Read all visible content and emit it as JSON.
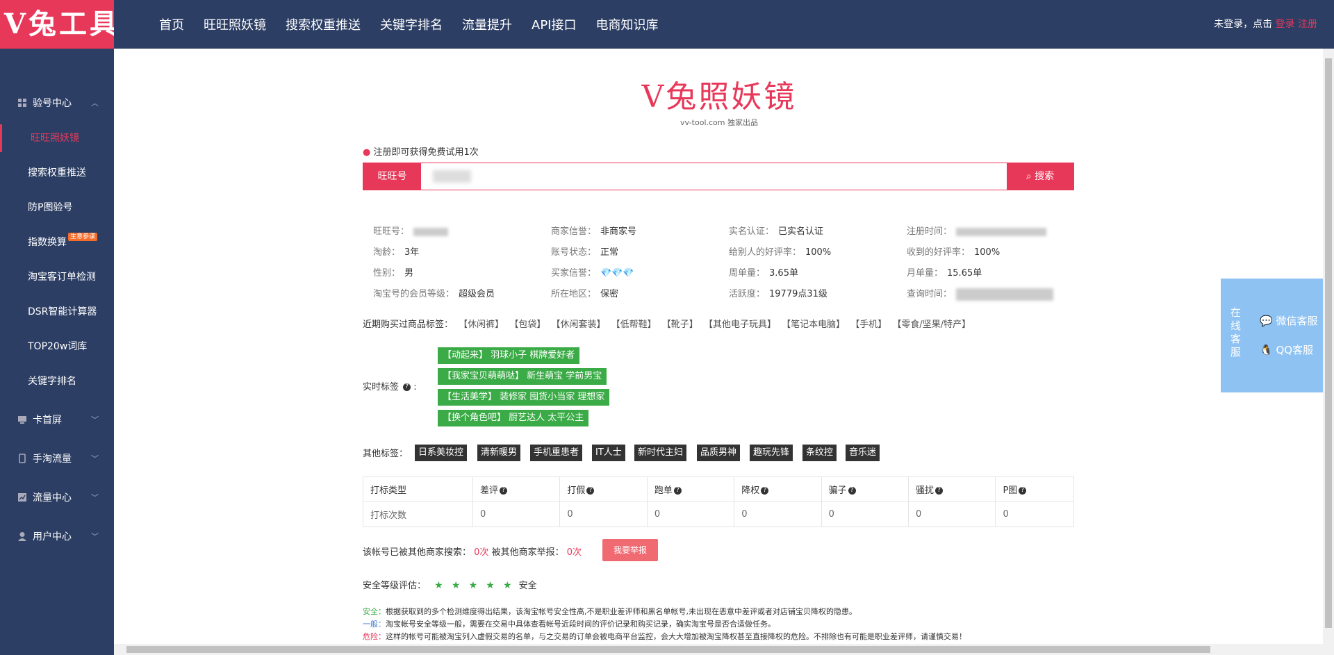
{
  "header": {
    "logo": "V兔工具",
    "nav": [
      "首页",
      "旺旺照妖镜",
      "搜索权重推送",
      "关键字排名",
      "流量提升",
      "API接口",
      "电商知识库"
    ],
    "login_prefix": "未登录，点击",
    "login": "登录",
    "register": "注册"
  },
  "sidebar": {
    "group1": "验号中心",
    "items": [
      "旺旺照妖镜",
      "搜索权重推送",
      "防P图验号",
      "指数换算",
      "淘宝客订单检测",
      "DSR智能计算器",
      "TOP20w词库",
      "关键字排名"
    ],
    "badge": "生意参谋",
    "group2": "卡首屏",
    "group3": "手淘流量",
    "group4": "流量中心",
    "group5": "用户中心"
  },
  "brand": {
    "title": "V兔照妖镜",
    "subtitle": "vv-tool.com 独家出品"
  },
  "tip": "注册即可获得免费试用1次",
  "search": {
    "label": "旺旺号",
    "button": "搜索"
  },
  "info": {
    "ww_label": "旺旺号：",
    "seller_credit_label": "商家信誉：",
    "seller_credit": "非商家号",
    "realname_label": "实名认证：",
    "realname": "已实名认证",
    "reg_time_label": "注册时间：",
    "age_label": "淘龄：",
    "age": "3年",
    "account_status_label": "账号状态：",
    "account_status": "正常",
    "good_rate_give_label": "给别人的好评率：",
    "good_rate_give": "100%",
    "good_rate_recv_label": "收到的好评率：",
    "good_rate_recv": "100%",
    "gender_label": "性别：",
    "gender": "男",
    "buyer_credit_label": "买家信誉：",
    "buyer_credit": "💎💎💎",
    "week_orders_label": "周单量：",
    "week_orders": "3.65单",
    "month_orders_label": "月单量：",
    "month_orders": "15.65单",
    "member_level_label": "淘宝号的会员等级：",
    "member_level": "超级会员",
    "region_label": "所在地区：",
    "region": "保密",
    "activity_label": "活跃度：",
    "activity": "19779点31级",
    "query_time_label": "查询时间："
  },
  "recent_tags": {
    "label": "近期购买过商品标签：",
    "tags": [
      "【休闲裤】",
      "【包袋】",
      "【休闲套装】",
      "【低帮鞋】",
      "【靴子】",
      "【其他电子玩具】",
      "【笔记本电脑】",
      "【手机】",
      "【零食/坚果/特产】"
    ]
  },
  "realtime_tags": {
    "label": "实时标签",
    "tags": [
      "【动起来】 羽球小子 棋牌爱好者",
      "【我家宝贝萌萌哒】 新生萌宝 学前男宝",
      "【生活美学】 装修家 囤货小当家 理想家",
      "【换个角色吧】 厨艺达人 太平公主"
    ]
  },
  "other_tags": {
    "label": "其他标签：",
    "tags": [
      "日系美妆控",
      "清新暖男",
      "手机重患者",
      "IT人士",
      "新时代主妇",
      "品质男神",
      "趣玩先锋",
      "条纹控",
      "音乐迷"
    ]
  },
  "stats": {
    "headers": [
      "打标类型",
      "差评",
      "打假",
      "跑单",
      "降权",
      "骗子",
      "骚扰",
      "P图"
    ],
    "row_label": "打标次数",
    "values": [
      "0",
      "0",
      "0",
      "0",
      "0",
      "0",
      "0"
    ]
  },
  "report": {
    "text1": "该帐号已被其他商家搜索：",
    "count1": "0次",
    "text2": "被其他商家举报：",
    "count2": "0次",
    "button": "我要举报"
  },
  "safety": {
    "label": "安全等级评估：",
    "level": "安全",
    "stars": 5
  },
  "notes": {
    "safe_label": "安全：",
    "safe": "根据获取到的多个检测维度得出结果，该淘宝帐号安全性高,不是职业差评师和黑名单帐号,未出现在恶意中差评或者对店铺宝贝降权的隐患。",
    "normal_label": "一般：",
    "normal": "淘宝帐号安全等级一般，需要在交易中具体查看帐号近段时间的评价记录和购买记录，确实淘宝号是否合适做任务。",
    "danger_label": "危险：",
    "danger": "这样的帐号可能被淘宝列入虚假交易的名单，与之交易的订单会被电商平台监控，会大大增加被淘宝降权甚至直接降权的危险。不排除也有可能是职业差评师，请谨慎交易！"
  },
  "service": {
    "vertical": "在线客服",
    "wechat": "微信客服",
    "qq": "QQ客服"
  },
  "colors": {
    "nav_bg": "#2c3e64",
    "accent": "#e8385a",
    "tag_green": "#3aab46",
    "service_blue": "#8ec2f2"
  }
}
